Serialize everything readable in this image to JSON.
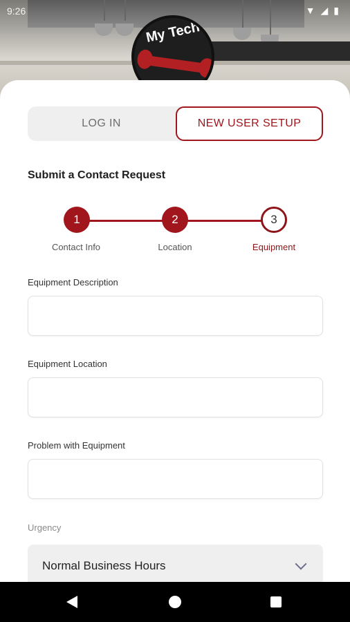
{
  "status": {
    "time": "9:26"
  },
  "logo": {
    "text": "My Tech"
  },
  "tabs": {
    "login": "LOG IN",
    "new_user": "NEW USER SETUP"
  },
  "page_title": "Submit a Contact Request",
  "stepper": {
    "steps": [
      {
        "number": "1",
        "label": "Contact Info"
      },
      {
        "number": "2",
        "label": "Location"
      },
      {
        "number": "3",
        "label": "Equipment"
      }
    ],
    "accent": "#a0161c"
  },
  "form": {
    "equipment_description": {
      "label": "Equipment Description",
      "value": ""
    },
    "equipment_location": {
      "label": "Equipment Location",
      "value": ""
    },
    "problem": {
      "label": "Problem with Equipment",
      "value": ""
    },
    "urgency": {
      "label": "Urgency",
      "value": "Normal Business Hours"
    }
  }
}
